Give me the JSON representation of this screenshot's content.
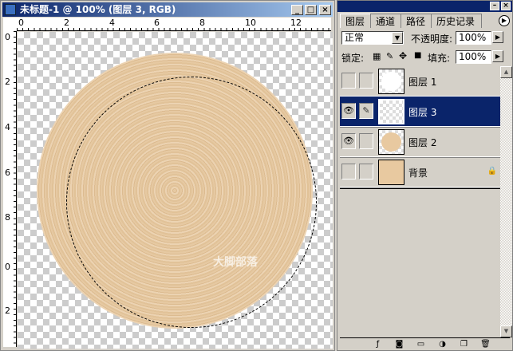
{
  "document": {
    "title": "未标题-1 @ 100% (图层 3, RGB)",
    "ruler_top": [
      "0",
      "2",
      "4",
      "6",
      "8",
      "10",
      "12"
    ],
    "ruler_left": [
      "0",
      "2",
      "4",
      "6",
      "8",
      "0",
      "2"
    ],
    "watermark": "大脚部落"
  },
  "panel": {
    "tabs": [
      "图层",
      "通道",
      "路径",
      "历史记录"
    ],
    "active_tab": "图层",
    "blend_mode": "正常",
    "opacity_label": "不透明度:",
    "opacity": "100%",
    "lock_label": "锁定:",
    "fill_label": "填充:",
    "fill": "100%",
    "layers": [
      {
        "name": "图层 1",
        "visible": false,
        "selected": false
      },
      {
        "name": "图层 3",
        "visible": true,
        "selected": true
      },
      {
        "name": "图层 2",
        "visible": true,
        "selected": false
      },
      {
        "name": "背景",
        "visible": false,
        "selected": false,
        "locked": true
      }
    ]
  },
  "colors": {
    "selection": "#0a246a",
    "wood": "#e6c9a2"
  }
}
